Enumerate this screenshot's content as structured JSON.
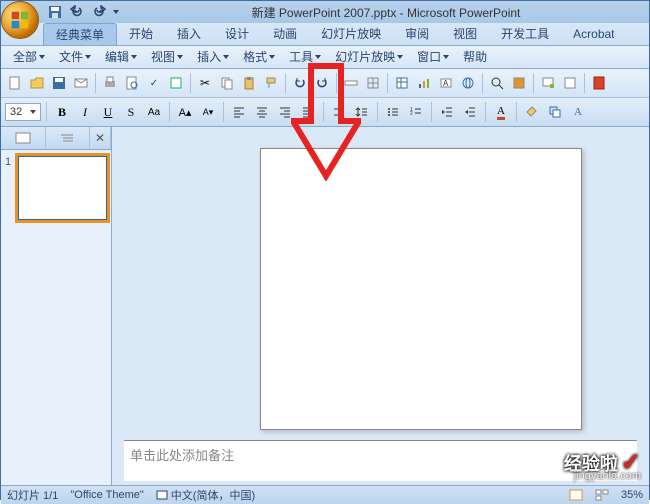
{
  "title": "新建 PowerPoint 2007.pptx - Microsoft PowerPoint",
  "ribbon_tabs": [
    "经典菜单",
    "开始",
    "插入",
    "设计",
    "动画",
    "幻灯片放映",
    "审阅",
    "视图",
    "开发工具",
    "Acrobat"
  ],
  "active_tab": 0,
  "menu_items": [
    "全部",
    "文件",
    "编辑",
    "视图",
    "插入",
    "格式",
    "工具",
    "幻灯片放映",
    "窗口",
    "帮助"
  ],
  "font_size": "32",
  "slides": [
    {
      "number": "1"
    }
  ],
  "notes_placeholder": "单击此处添加备注",
  "status": {
    "slide_info": "幻灯片 1/1",
    "theme": "\"Office Theme\"",
    "language": "中文(简体，中国)",
    "zoom": "35%"
  },
  "watermark": {
    "brand": "经验啦",
    "url": "jingyanla.com"
  }
}
